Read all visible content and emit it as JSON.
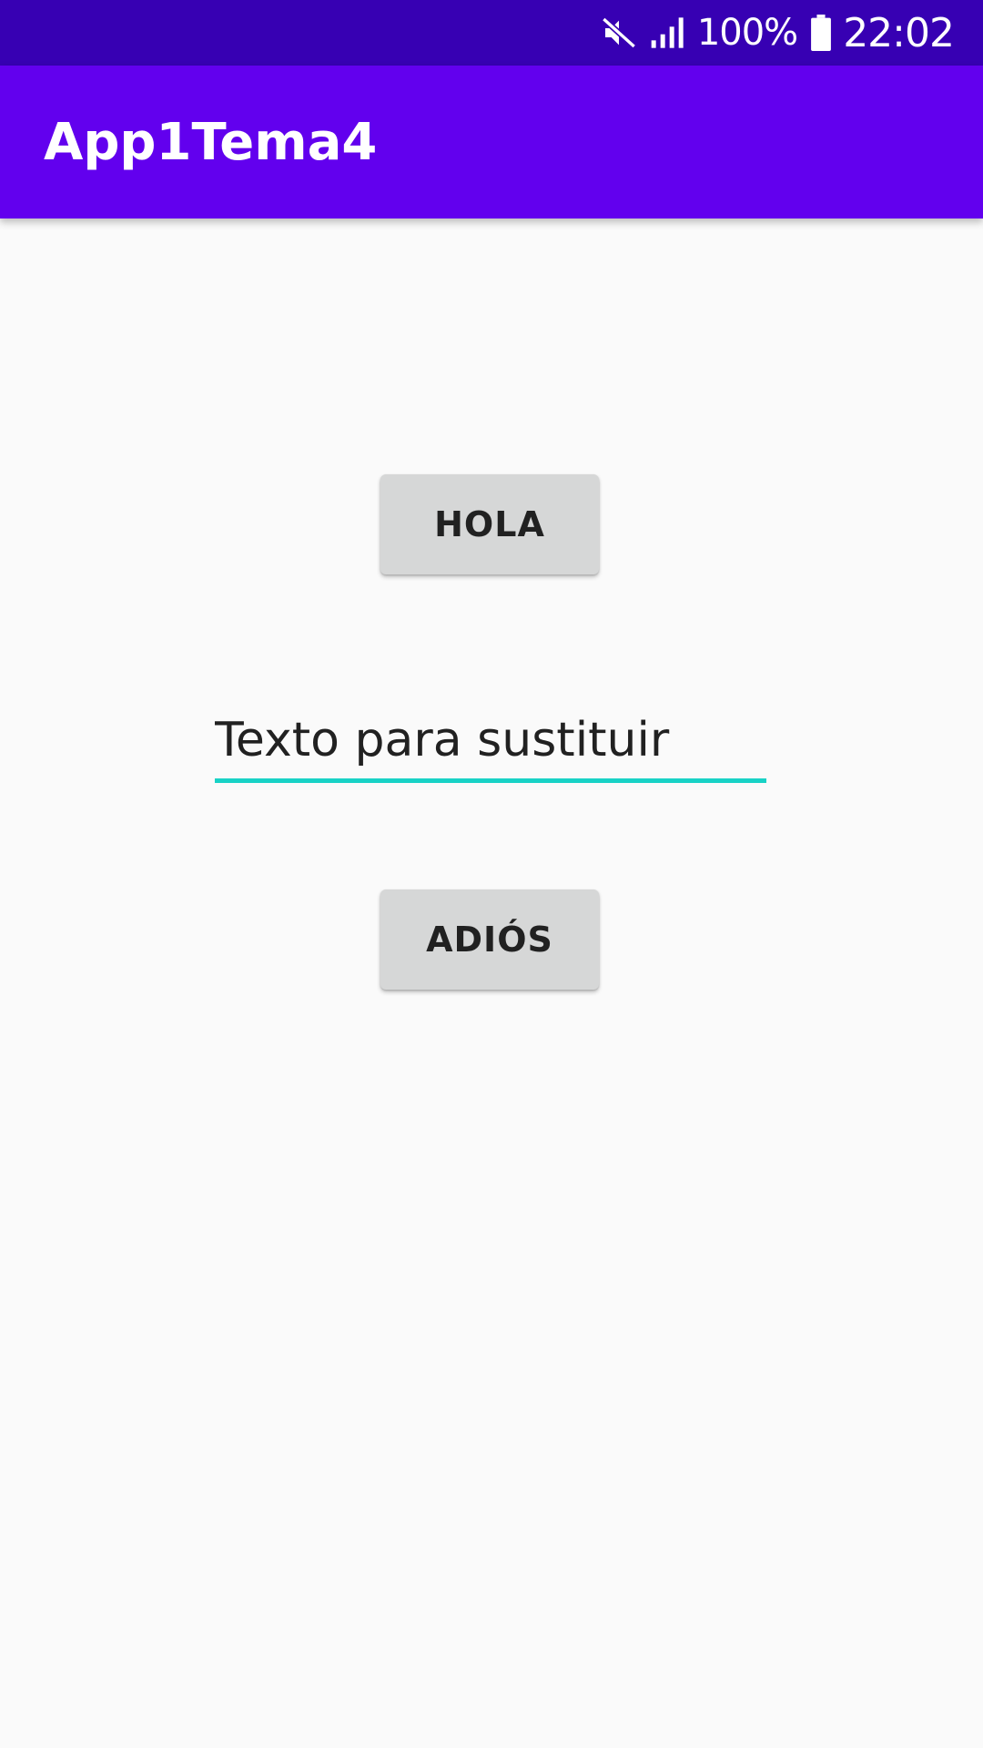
{
  "status_bar": {
    "icons": [
      "mute-icon",
      "signal-icon",
      "battery-icon"
    ],
    "battery_level": "100%",
    "time": "22:02",
    "background": "#3700b3"
  },
  "app_bar": {
    "title": "App1Tema4",
    "background": "#6200ee"
  },
  "main": {
    "hola_button_label": "HOLA",
    "text_field_value": "Texto para sustituir",
    "text_field_underline_color": "#18d2c6",
    "adios_button_label": "ADIÓS"
  }
}
